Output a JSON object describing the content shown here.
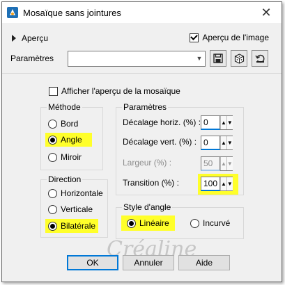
{
  "window": {
    "title": "Mosaïque sans jointures",
    "close": "✕"
  },
  "preview": {
    "label": "Aperçu",
    "image_preview_label": "Aperçu de l'image",
    "image_preview_checked": true
  },
  "presets": {
    "label": "Paramètres",
    "value": ""
  },
  "show_preview": {
    "label": "Afficher l'aperçu de la mosaïque",
    "checked": false
  },
  "method": {
    "title": "Méthode",
    "options": [
      "Bord",
      "Angle",
      "Miroir"
    ],
    "selected": "Angle"
  },
  "direction": {
    "title": "Direction",
    "options": [
      "Horizontale",
      "Verticale",
      "Bilatérale"
    ],
    "selected": "Bilatérale"
  },
  "parameters": {
    "title": "Paramètres",
    "horiz_label": "Décalage horiz. (%) :",
    "horiz_value": "0",
    "vert_label": "Décalage vert. (%) :",
    "vert_value": "0",
    "width_label": "Largeur (%) :",
    "width_value": "50",
    "transition_label": "Transition (%) :",
    "transition_value": "100"
  },
  "angle_style": {
    "title": "Style d'angle",
    "options": [
      "Linéaire",
      "Incurvé"
    ],
    "selected": "Linéaire"
  },
  "buttons": {
    "ok": "OK",
    "cancel": "Annuler",
    "help": "Aide"
  },
  "watermark": "Créaline",
  "colors": {
    "highlight": "#ffff2a",
    "accent": "#0078d7"
  }
}
